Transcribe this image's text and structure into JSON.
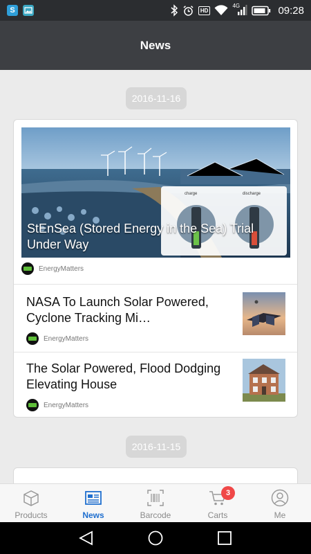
{
  "status_bar": {
    "app_icons": [
      "S",
      "image-icon"
    ],
    "icons": [
      "bluetooth-icon",
      "alarm-icon",
      "hd-icon",
      "wifi-icon",
      "signal-4g-icon",
      "battery-icon"
    ],
    "hd_label": "HD",
    "network_label": "4G",
    "time": "09:28"
  },
  "header": {
    "title": "News"
  },
  "feed": [
    {
      "date": "2016-11-16",
      "articles": [
        {
          "title": "StEnSea (Stored Energy in the Sea) Trial Under Way",
          "source": "EnergyMatters",
          "featured": true,
          "image_labels": [
            "charge",
            "discharge"
          ]
        },
        {
          "title": "NASA To Launch Solar Powered, Cyclone Tracking Mi…",
          "source": "EnergyMatters"
        },
        {
          "title": "The Solar Powered, Flood Dodging Elevating House",
          "source": "EnergyMatters"
        }
      ]
    },
    {
      "date": "2016-11-15",
      "articles": []
    }
  ],
  "bottom_nav": {
    "tabs": [
      {
        "label": "Products",
        "icon": "box-icon"
      },
      {
        "label": "News",
        "icon": "newspaper-icon",
        "active": true
      },
      {
        "label": "Barcode",
        "icon": "barcode-scan-icon"
      },
      {
        "label": "Carts",
        "icon": "cart-icon",
        "badge": "3"
      },
      {
        "label": "Me",
        "icon": "user-icon"
      }
    ]
  },
  "system_nav": [
    "back-icon",
    "home-icon",
    "recents-icon"
  ],
  "colors": {
    "status_bar": "#2b2d30",
    "title_bar": "#3d3f43",
    "background": "#ebebeb",
    "accent": "#1f6fcf",
    "badge": "#f04848"
  }
}
